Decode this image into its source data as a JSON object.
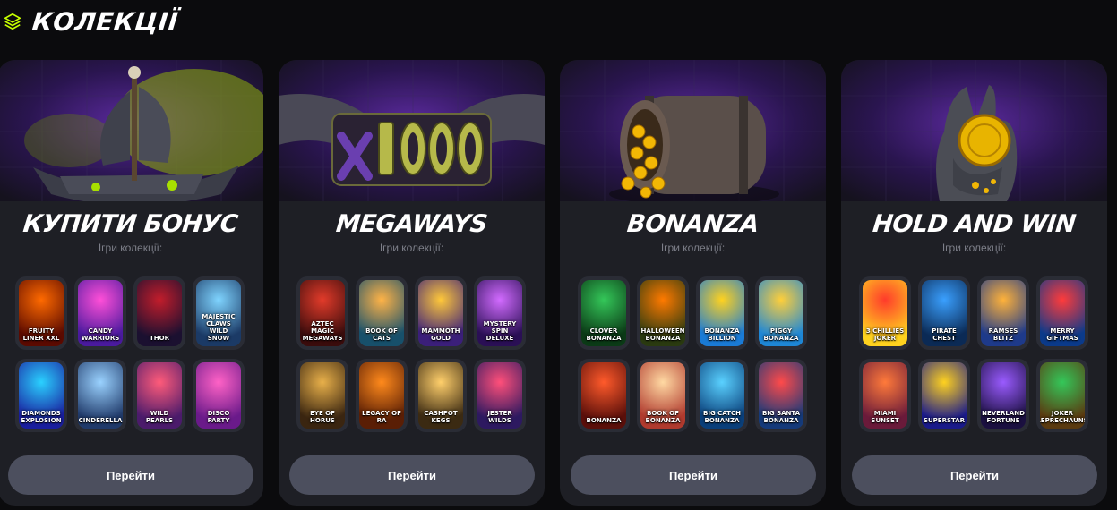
{
  "header": {
    "title": "КОЛЕКЦІЇ",
    "icon": "layers-icon",
    "icon_color": "#c6ff00"
  },
  "subtitle_label": "Ігри колекції:",
  "button_label": "Перейти",
  "collections": [
    {
      "title": "КУПИТИ БОНУС",
      "art": "pirate-ship",
      "games": [
        {
          "name": "FRUITY LINER XXL",
          "colors": [
            "#ff6a00",
            "#5b0a00"
          ]
        },
        {
          "name": "CANDY WARRIORS",
          "colors": [
            "#ff4fd8",
            "#4a1a9e"
          ]
        },
        {
          "name": "THOR",
          "colors": [
            "#c21d2b",
            "#1b1030"
          ]
        },
        {
          "name": "MAJESTIC CLAWS WILD SNOW",
          "colors": [
            "#7fd4ff",
            "#1b3a66"
          ]
        },
        {
          "name": "DIAMONDS EXPLOSION",
          "colors": [
            "#2ad1ff",
            "#1a1e9e"
          ]
        },
        {
          "name": "CINDERELLA",
          "colors": [
            "#9ad2ff",
            "#203a6a"
          ]
        },
        {
          "name": "WILD PEARLS",
          "colors": [
            "#ff5b7a",
            "#4b1b6b"
          ]
        },
        {
          "name": "DISCO PARTY",
          "colors": [
            "#ff62c6",
            "#6a1a8a"
          ]
        }
      ]
    },
    {
      "title": "MEGAWAYS",
      "art": "x1000",
      "games": [
        {
          "name": "AZTEC MAGIC MEGAWAYS",
          "colors": [
            "#e23b2a",
            "#3a0c0c"
          ]
        },
        {
          "name": "BOOK OF CATS",
          "colors": [
            "#ffb347",
            "#17506b"
          ]
        },
        {
          "name": "MAMMOTH GOLD",
          "colors": [
            "#ffc83a",
            "#3b1f7a"
          ]
        },
        {
          "name": "MYSTERY SPIN DELUXE",
          "colors": [
            "#d26bff",
            "#2a0f55"
          ]
        },
        {
          "name": "EYE OF HORUS",
          "colors": [
            "#e8b04a",
            "#3a2510"
          ]
        },
        {
          "name": "LEGACY OF RA",
          "colors": [
            "#ff8a1c",
            "#5a1e05"
          ]
        },
        {
          "name": "CASHPOT KEGS",
          "colors": [
            "#ffcf6b",
            "#3b2a12"
          ]
        },
        {
          "name": "JESTER WILDS",
          "colors": [
            "#ff4f7a",
            "#2d1960"
          ]
        }
      ]
    },
    {
      "title": "BONANZA",
      "art": "barrel",
      "games": [
        {
          "name": "CLOVER BONANZA",
          "colors": [
            "#34c759",
            "#0b3a16"
          ]
        },
        {
          "name": "HALLOWEEN BONANZA",
          "colors": [
            "#ff7a00",
            "#2a3a10"
          ]
        },
        {
          "name": "BONANZA BILLION",
          "colors": [
            "#ffd21f",
            "#1a7bd6"
          ]
        },
        {
          "name": "PIGGY BONANZA",
          "colors": [
            "#ffcf3a",
            "#1e87d6"
          ]
        },
        {
          "name": "BONANZA",
          "colors": [
            "#ff5a2b",
            "#5a0f0a"
          ]
        },
        {
          "name": "BOOK OF BONANZA",
          "colors": [
            "#ffd9a3",
            "#b03a2e"
          ]
        },
        {
          "name": "BIG CATCH BONANZA",
          "colors": [
            "#5ad1ff",
            "#0a3f7a"
          ]
        },
        {
          "name": "BIG SANTA BONANZA",
          "colors": [
            "#ff4a4a",
            "#153a7a"
          ]
        }
      ]
    },
    {
      "title": "HOLD AND WIN",
      "art": "hand-coin",
      "games": [
        {
          "name": "3 CHILLIES JOKER",
          "colors": [
            "#ff3b2b",
            "#ffd21f"
          ]
        },
        {
          "name": "PIRATE CHEST",
          "colors": [
            "#3aa0ff",
            "#0b2a55"
          ]
        },
        {
          "name": "RAMSES BLITZ",
          "colors": [
            "#ffb23a",
            "#1e3a8a"
          ]
        },
        {
          "name": "MERRY GIFTMAS",
          "colors": [
            "#ff3b3b",
            "#0b3a8a"
          ]
        },
        {
          "name": "MIAMI SUNSET",
          "colors": [
            "#ff7a3a",
            "#6a1a3a"
          ]
        },
        {
          "name": "SUPERSTAR",
          "colors": [
            "#ffd21f",
            "#1a1a8a"
          ]
        },
        {
          "name": "NEVERLAND FORTUNE",
          "colors": [
            "#9a5bff",
            "#1b1040"
          ]
        },
        {
          "name": "JOKER LEPRECHAUNS",
          "colors": [
            "#34c759",
            "#5a3a10"
          ]
        }
      ]
    }
  ]
}
